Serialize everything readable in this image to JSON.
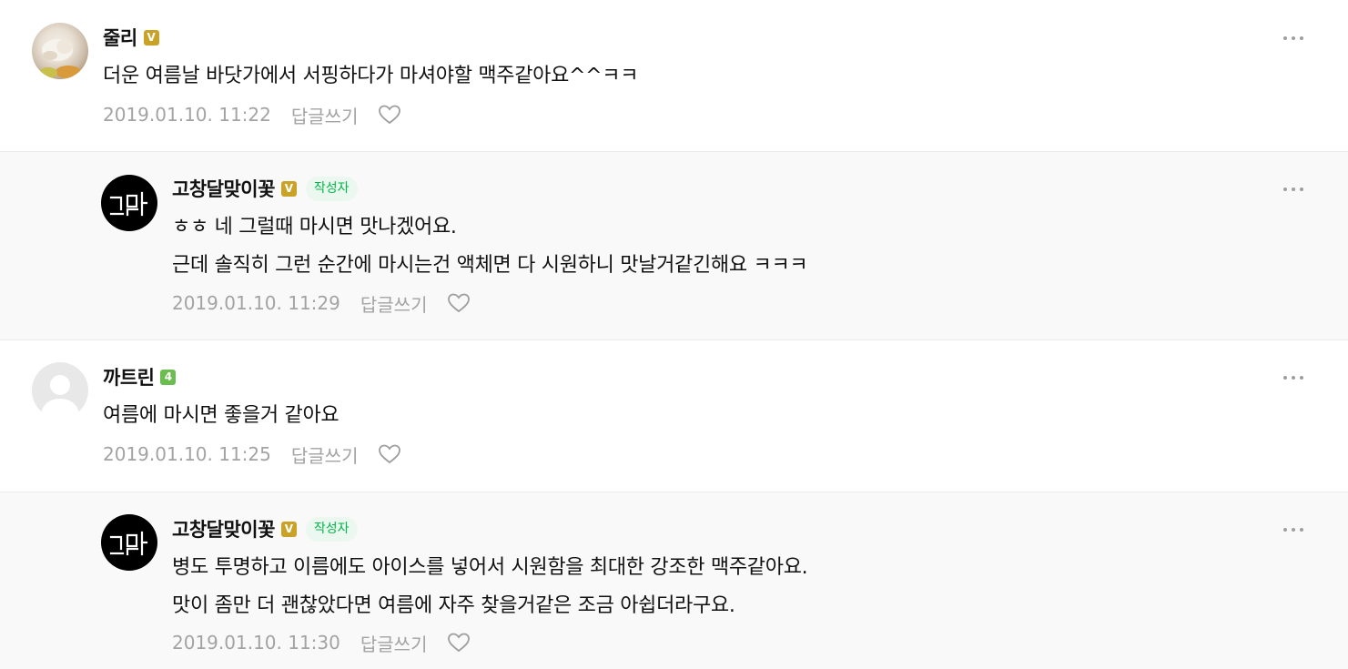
{
  "comments": [
    {
      "author": "줄리",
      "level_badge": "V",
      "lines": [
        "더운 여름날 바닷가에서 서핑하다가 마셔야할 맥주같아요^^ㅋㅋ"
      ],
      "date": "2019.01.10. 11:22",
      "reply_label": "답글쓰기"
    },
    {
      "author": "고창달맞이꽃",
      "level_badge": "V",
      "writer_badge": "작성자",
      "lines": [
        "ㅎㅎ 네 그럴때 마시면 맛나겠어요.",
        "근데 솔직히 그런 순간에 마시는건 액체면 다 시원하니 맛날거같긴해요 ㅋㅋㅋ"
      ],
      "date": "2019.01.10. 11:29",
      "reply_label": "답글쓰기"
    },
    {
      "author": "까트린",
      "level_badge": "4",
      "lines": [
        "여름에 마시면 좋을거 같아요"
      ],
      "date": "2019.01.10. 11:25",
      "reply_label": "답글쓰기"
    },
    {
      "author": "고창달맞이꽃",
      "level_badge": "V",
      "writer_badge": "작성자",
      "lines": [
        "병도 투명하고 이름에도 아이스를 넣어서 시원함을 최대한 강조한 맥주같아요.",
        "맛이 좀만 더 괜찮았다면 여름에 자주 찾을거같은 조금 아쉽더라구요."
      ],
      "date": "2019.01.10. 11:30",
      "reply_label": "답글쓰기"
    }
  ],
  "icons": {
    "more": "more-icon",
    "heart": "heart-icon",
    "default_avatar": "person-icon",
    "logo_avatar": "logo-icon"
  },
  "colors": {
    "meta_text": "#a3a3a3",
    "writer_badge_text": "#03b54a",
    "writer_badge_bg": "#ebf8ef",
    "level_gold": "#c9a227",
    "level_green": "#6bbd4f",
    "reply_bg": "#f9f9f9"
  }
}
